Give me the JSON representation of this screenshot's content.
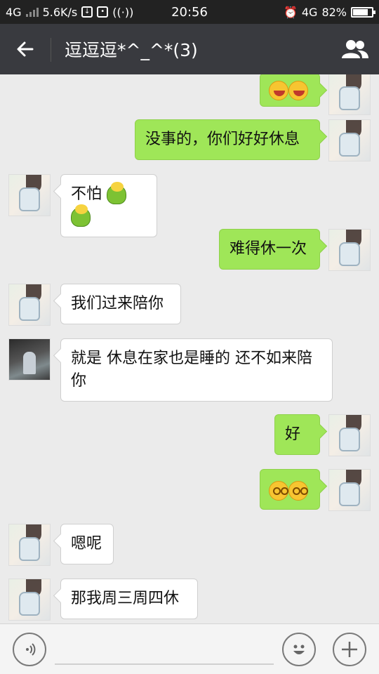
{
  "status_bar": {
    "network_left": "4G",
    "speed": "5.6K/s",
    "time": "20:56",
    "network_right": "4G",
    "battery_percent": "82%",
    "battery_level": 0.82
  },
  "header": {
    "title": "逗逗逗*^_^*(3)",
    "back_icon": "arrow-left-icon",
    "members_icon": "group-members-icon"
  },
  "messages": [
    {
      "dir": "out",
      "text": "",
      "emoji": [
        "laugh",
        "laugh"
      ]
    },
    {
      "dir": "out",
      "text": "没事的，你们好好休息"
    },
    {
      "dir": "in",
      "text": "不怕",
      "emoji": [
        "frog",
        "frog"
      ]
    },
    {
      "dir": "out",
      "text": "难得休一次"
    },
    {
      "dir": "in",
      "text": "我们过来陪你"
    },
    {
      "dir": "in",
      "text": "就是  休息在家也是睡的  还不如来陪你",
      "avatar": "photo"
    },
    {
      "dir": "out",
      "text": "好"
    },
    {
      "dir": "out",
      "text": "",
      "emoji": [
        "sly",
        "sly"
      ]
    },
    {
      "dir": "in",
      "text": "嗯呢"
    },
    {
      "dir": "in",
      "text": "那我周三周四休"
    }
  ],
  "input_bar": {
    "voice_icon": "voice-icon",
    "emoji_icon": "emoji-icon",
    "plus_icon": "plus-icon"
  },
  "colors": {
    "header_bg": "#393a3f",
    "status_bg": "#222222",
    "chat_bg": "#ebebeb",
    "out_bubble": "#9fe658",
    "in_bubble": "#ffffff"
  }
}
